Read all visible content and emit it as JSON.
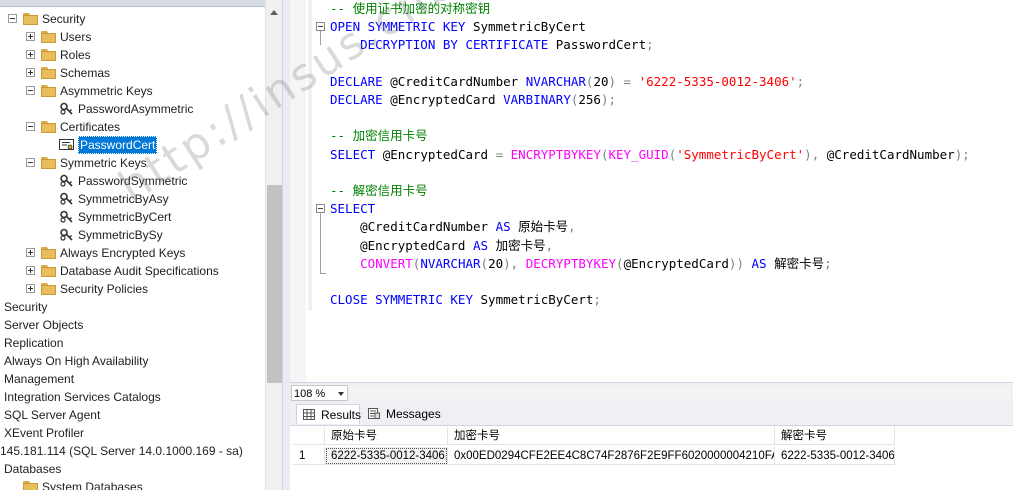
{
  "explorer": {
    "top_label": "",
    "nodes": [
      {
        "label": "Security",
        "indent": 0,
        "icon": "folder-icon",
        "expander": "minus"
      },
      {
        "label": "Users",
        "indent": 1,
        "icon": "folder-icon",
        "expander": "plus"
      },
      {
        "label": "Roles",
        "indent": 1,
        "icon": "folder-icon",
        "expander": "plus"
      },
      {
        "label": "Schemas",
        "indent": 1,
        "icon": "folder-icon",
        "expander": "plus"
      },
      {
        "label": "Asymmetric Keys",
        "indent": 1,
        "icon": "folder-icon",
        "expander": "minus"
      },
      {
        "label": "PasswordAsymmetric",
        "indent": 2,
        "icon": "key-icon",
        "expander": "none"
      },
      {
        "label": "Certificates",
        "indent": 1,
        "icon": "folder-icon",
        "expander": "minus"
      },
      {
        "label": "PasswordCert",
        "indent": 2,
        "icon": "certificate-icon",
        "expander": "none",
        "selected": true
      },
      {
        "label": "Symmetric Keys",
        "indent": 1,
        "icon": "folder-icon",
        "expander": "minus"
      },
      {
        "label": "PasswordSymmetric",
        "indent": 2,
        "icon": "key-icon",
        "expander": "none"
      },
      {
        "label": "SymmetricByAsy",
        "indent": 2,
        "icon": "key-icon",
        "expander": "none"
      },
      {
        "label": "SymmetricByCert",
        "indent": 2,
        "icon": "key-icon",
        "expander": "none"
      },
      {
        "label": "SymmetricBySy",
        "indent": 2,
        "icon": "key-icon",
        "expander": "none"
      },
      {
        "label": "Always Encrypted Keys",
        "indent": 1,
        "icon": "folder-icon",
        "expander": "plus"
      },
      {
        "label": "Database Audit Specifications",
        "indent": 1,
        "icon": "folder-icon",
        "expander": "plus"
      },
      {
        "label": "Security Policies",
        "indent": 1,
        "icon": "folder-icon",
        "expander": "plus"
      },
      {
        "label": "Security",
        "indent": -1,
        "icon": "",
        "expander": "none"
      },
      {
        "label": "Server Objects",
        "indent": -1,
        "icon": "",
        "expander": "none"
      },
      {
        "label": "Replication",
        "indent": -1,
        "icon": "",
        "expander": "none"
      },
      {
        "label": "Always On High Availability",
        "indent": -1,
        "icon": "",
        "expander": "none"
      },
      {
        "label": "Management",
        "indent": -1,
        "icon": "",
        "expander": "none"
      },
      {
        "label": "Integration Services Catalogs",
        "indent": -1,
        "icon": "",
        "expander": "none"
      },
      {
        "label": "SQL Server Agent",
        "indent": -1,
        "icon": "",
        "expander": "none"
      },
      {
        "label": "XEvent Profiler",
        "indent": -1,
        "icon": "",
        "expander": "none"
      },
      {
        "label": "145.181.114 (SQL Server 14.0.1000.169 - sa)",
        "indent": -2,
        "icon": "",
        "expander": "none"
      },
      {
        "label": "Databases",
        "indent": -1,
        "icon": "",
        "expander": "none"
      },
      {
        "label": "System Databases",
        "indent": 0,
        "icon": "folder-icon",
        "expander": "none"
      }
    ]
  },
  "editor": {
    "lines": [
      [
        [
          "cm",
          "-- 使用证书加密的对称密钥"
        ]
      ],
      [
        [
          "kw",
          "OPEN SYMMETRIC KEY "
        ],
        [
          "",
          "SymmetricByCert"
        ]
      ],
      [
        [
          "kw",
          "    DECRYPTION BY CERTIFICATE "
        ],
        [
          "",
          "PasswordCert"
        ],
        [
          "op",
          ";"
        ]
      ],
      [],
      [
        [
          "kw",
          "DECLARE "
        ],
        [
          "",
          "@CreditCardNumber "
        ],
        [
          "kw",
          "NVARCHAR"
        ],
        [
          "op",
          "("
        ],
        [
          "",
          "20"
        ],
        [
          "op",
          ") = "
        ],
        [
          "str",
          "'6222-5335-0012-3406'"
        ],
        [
          "op",
          ";"
        ]
      ],
      [
        [
          "kw",
          "DECLARE "
        ],
        [
          "",
          "@EncryptedCard "
        ],
        [
          "kw",
          "VARBINARY"
        ],
        [
          "op",
          "("
        ],
        [
          "",
          "256"
        ],
        [
          "op",
          ");"
        ]
      ],
      [],
      [
        [
          "cm",
          "-- 加密信用卡号"
        ]
      ],
      [
        [
          "kw",
          "SELECT "
        ],
        [
          "",
          "@EncryptedCard "
        ],
        [
          "op",
          "= "
        ],
        [
          "fn",
          "ENCRYPTBYKEY"
        ],
        [
          "op",
          "("
        ],
        [
          "fn",
          "KEY_GUID"
        ],
        [
          "op",
          "("
        ],
        [
          "str",
          "'SymmetricByCert'"
        ],
        [
          "op",
          "), "
        ],
        [
          "",
          "@CreditCardNumber"
        ],
        [
          "op",
          ");"
        ]
      ],
      [],
      [
        [
          "cm",
          "-- 解密信用卡号"
        ]
      ],
      [
        [
          "kw",
          "SELECT"
        ]
      ],
      [
        [
          "",
          "    @CreditCardNumber "
        ],
        [
          "kw",
          "AS "
        ],
        [
          "",
          "原始卡号"
        ],
        [
          "op",
          ","
        ]
      ],
      [
        [
          "",
          "    @EncryptedCard "
        ],
        [
          "kw",
          "AS "
        ],
        [
          "",
          "加密卡号"
        ],
        [
          "op",
          ","
        ]
      ],
      [
        [
          "fn",
          "    CONVERT"
        ],
        [
          "op",
          "("
        ],
        [
          "kw",
          "NVARCHAR"
        ],
        [
          "op",
          "("
        ],
        [
          "",
          "20"
        ],
        [
          "op",
          "), "
        ],
        [
          "fn",
          "DECRYPTBYKEY"
        ],
        [
          "op",
          "("
        ],
        [
          "",
          "@EncryptedCard"
        ],
        [
          "op",
          ")) "
        ],
        [
          "kw",
          "AS "
        ],
        [
          "",
          "解密卡号"
        ],
        [
          "op",
          ";"
        ]
      ],
      [],
      [
        [
          "kw",
          "CLOSE SYMMETRIC KEY "
        ],
        [
          "",
          "SymmetricByCert"
        ],
        [
          "op",
          ";"
        ]
      ]
    ]
  },
  "zoom": {
    "value": "108 %"
  },
  "results": {
    "tabs": [
      {
        "label": "Results",
        "icon": "grid-icon",
        "active": true
      },
      {
        "label": "Messages",
        "icon": "messages-icon",
        "active": false
      }
    ],
    "columns": [
      "原始卡号",
      "加密卡号",
      "解密卡号"
    ],
    "rows": [
      {
        "num": "1",
        "cells": [
          "6222-5335-0012-3406",
          "0x00ED0294CFE2EE4C8C74F2876F2E9FF6020000004210FA...",
          "6222-5335-0012-3406"
        ]
      }
    ]
  },
  "watermark": {
    "text": "http://insus.cnblogs.com"
  }
}
